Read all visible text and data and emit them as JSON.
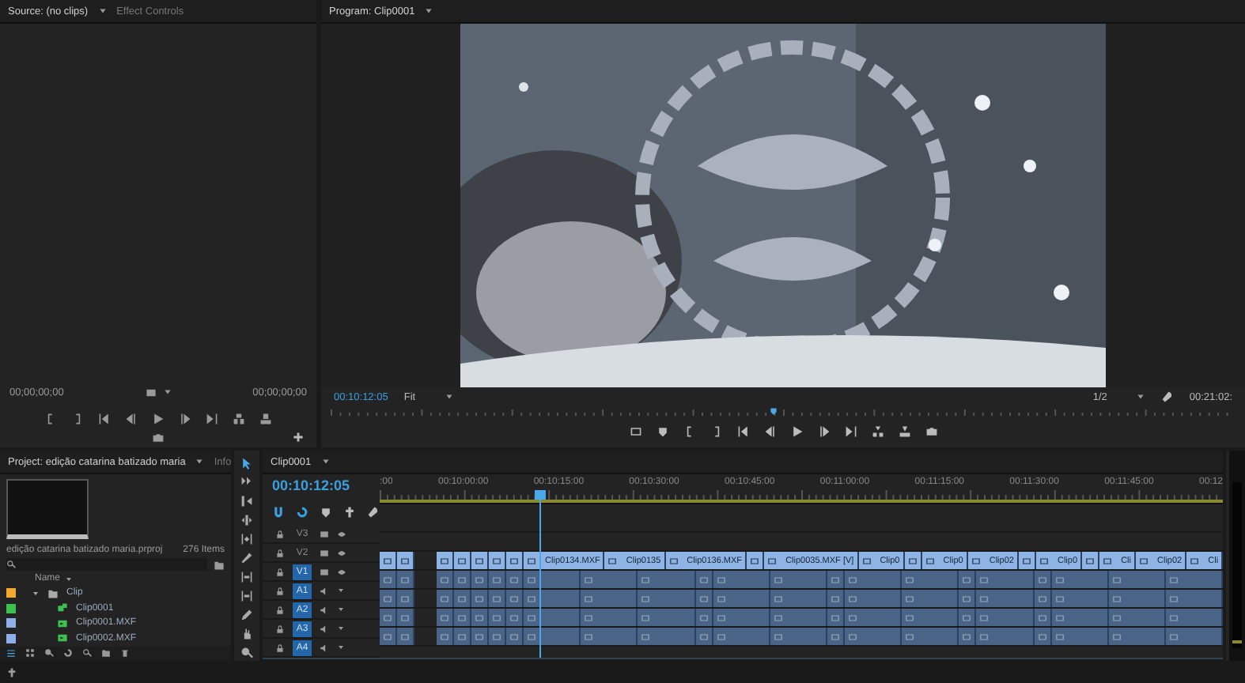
{
  "source_panel": {
    "tabs": [
      {
        "label": "Source: (no clips)",
        "selected": true
      },
      {
        "label": "Effect Controls",
        "selected": false
      }
    ],
    "timecode_in": "00;00;00;00",
    "timecode_out": "00;00;00;00"
  },
  "program_panel": {
    "tab": "Program: Clip0001",
    "timecode": "00:10:12:05",
    "fit": "Fit",
    "resolution": "1/2",
    "duration": "00:21:02:",
    "playhead": {
      "level": 0.49
    }
  },
  "project_panel": {
    "tabs": [
      {
        "label": "Project: edição catarina batizado maria",
        "selected": true
      },
      {
        "label": "Info",
        "selected": false
      }
    ],
    "file": "edição catarina batizado maria.prproj",
    "count": "276 Items",
    "column": "Name",
    "items": [
      {
        "name": "Clip",
        "kind": "folder",
        "expanded": true,
        "color": "#f0a830",
        "children": [
          {
            "name": "Clip0001",
            "kind": "sequence",
            "color": "#3cc050"
          },
          {
            "name": "Clip0001.MXF",
            "kind": "clip",
            "color": "#8eaee8"
          },
          {
            "name": "Clip0002.MXF",
            "kind": "clip",
            "color": "#8eaee8"
          }
        ]
      }
    ]
  },
  "timeline": {
    "tab": "Clip0001",
    "timecode": "00:10:12:05",
    "playhead": {
      "level": 0.19
    },
    "ruler": [
      ":00",
      "00:10:00:00",
      "00:10:15:00",
      "00:10:30:00",
      "00:10:45:00",
      "00:11:00:00",
      "00:11:15:00",
      "00:11:30:00",
      "00:11:45:00",
      "00:12"
    ],
    "tracks": [
      {
        "name": "V3",
        "kind": "video",
        "targeted": false
      },
      {
        "name": "V2",
        "kind": "video",
        "targeted": false
      },
      {
        "name": "V1",
        "kind": "video",
        "targeted": true
      },
      {
        "name": "A1",
        "kind": "audio",
        "targeted": true
      },
      {
        "name": "A2",
        "kind": "audio",
        "targeted": true
      },
      {
        "name": "A3",
        "kind": "audio",
        "targeted": true
      },
      {
        "name": "A4",
        "kind": "audio",
        "targeted": true
      }
    ],
    "clips": [
      {
        "kind": "clip"
      },
      {
        "kind": "clip"
      },
      {
        "kind": "gap"
      },
      {
        "kind": "clip"
      },
      {
        "kind": "clip"
      },
      {
        "kind": "clip"
      },
      {
        "kind": "clip"
      },
      {
        "kind": "clip"
      },
      {
        "kind": "clip",
        "label": "Clip0134.MXF"
      },
      {
        "kind": "clip",
        "label": "Clip0135"
      },
      {
        "kind": "clip",
        "label": "Clip0136.MXF"
      },
      {
        "kind": "clip"
      },
      {
        "kind": "clip",
        "label": "Clip0035.MXF [V]"
      },
      {
        "kind": "clip",
        "label": "Clip0"
      },
      {
        "kind": "clip"
      },
      {
        "kind": "clip",
        "label": "Clip0"
      },
      {
        "kind": "clip",
        "label": "Clip02"
      },
      {
        "kind": "clip"
      },
      {
        "kind": "clip",
        "label": "Clip0"
      },
      {
        "kind": "clip"
      },
      {
        "kind": "clip",
        "label": "Cli"
      },
      {
        "kind": "clip",
        "label": "Clip02"
      },
      {
        "kind": "clip",
        "label": "Cli"
      }
    ]
  }
}
